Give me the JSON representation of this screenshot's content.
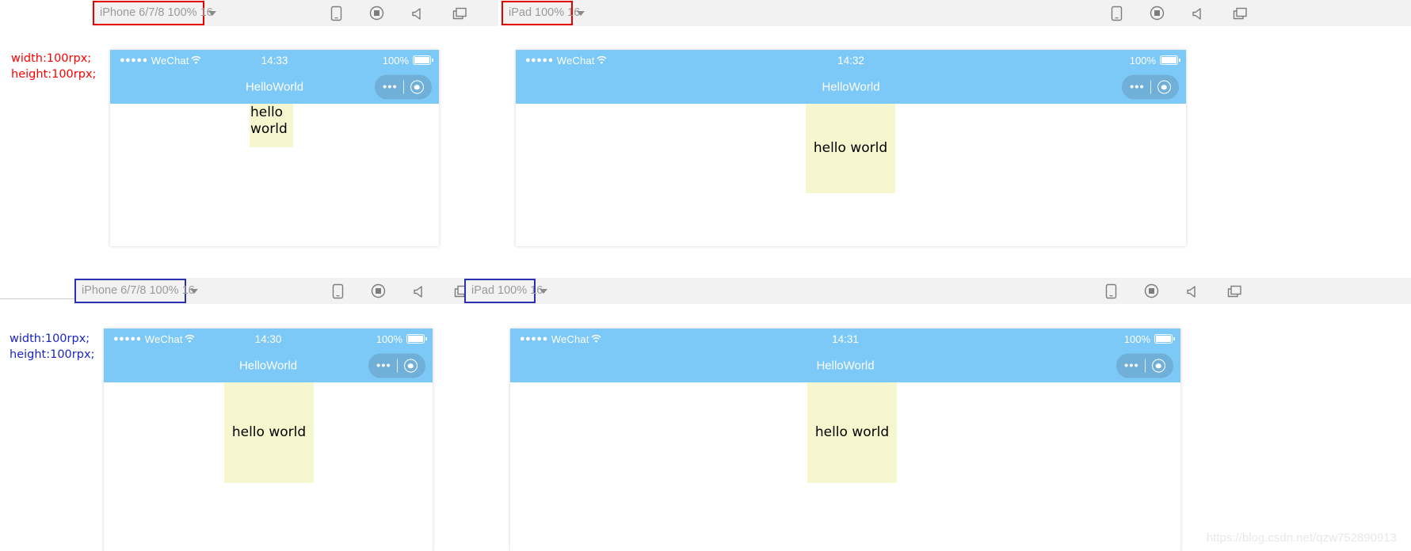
{
  "watermark": "https://blog.csdn.net/qzw752890913",
  "toolbars": [
    {
      "id": "top-iphone",
      "device_label": "iPhone 6/7/8 100% 16",
      "highlight_color": "#e60000",
      "icons": [
        "device-toggle-icon",
        "record-icon",
        "sound-icon",
        "window-icon"
      ]
    },
    {
      "id": "top-ipad",
      "device_label": "iPad 100% 16",
      "highlight_color": "#e60000",
      "icons": [
        "device-toggle-icon",
        "record-icon",
        "sound-icon",
        "window-icon"
      ]
    },
    {
      "id": "bottom-iphone",
      "device_label": "iPhone 6/7/8 100% 16",
      "highlight_color": "#2a32b0",
      "icons": [
        "device-toggle-icon",
        "record-icon",
        "sound-icon",
        "window-icon"
      ]
    },
    {
      "id": "bottom-ipad",
      "device_label": "iPad 100% 16",
      "highlight_color": "#2a32b0",
      "icons": [
        "device-toggle-icon",
        "record-icon",
        "sound-icon",
        "window-icon"
      ]
    }
  ],
  "annotations": [
    {
      "id": "top",
      "color": "#ff0000",
      "line1": "width:100rpx;",
      "line2": "height:100rpx;"
    },
    {
      "id": "bottom",
      "color": "#1a25c4",
      "line1": "width:100rpx;",
      "line2": "height:100rpx;"
    }
  ],
  "simulators": [
    {
      "id": "top-iphone-sim",
      "carrier": "WeChat",
      "signal_dots": "●●●●●",
      "time": "14:33",
      "battery_percent": "100%",
      "nav_title": "HelloWorld",
      "content_text": "hello world",
      "content_bg": "#f7f7cf",
      "header_bg": "#7cc8f7"
    },
    {
      "id": "top-ipad-sim",
      "carrier": "WeChat",
      "signal_dots": "●●●●●",
      "time": "14:32",
      "battery_percent": "100%",
      "nav_title": "HelloWorld",
      "content_text": "hello world",
      "content_bg": "#f7f7cf",
      "header_bg": "#7cc8f7"
    },
    {
      "id": "bottom-iphone-sim",
      "carrier": "WeChat",
      "signal_dots": "●●●●●",
      "time": "14:30",
      "battery_percent": "100%",
      "nav_title": "HelloWorld",
      "content_text": "hello world",
      "content_bg": "#f7f7cf",
      "header_bg": "#7cc8f7"
    },
    {
      "id": "bottom-ipad-sim",
      "carrier": "WeChat",
      "signal_dots": "●●●●●",
      "time": "14:31",
      "battery_percent": "100%",
      "nav_title": "HelloWorld",
      "content_text": "hello world",
      "content_bg": "#f7f7cf",
      "header_bg": "#7cc8f7"
    }
  ]
}
